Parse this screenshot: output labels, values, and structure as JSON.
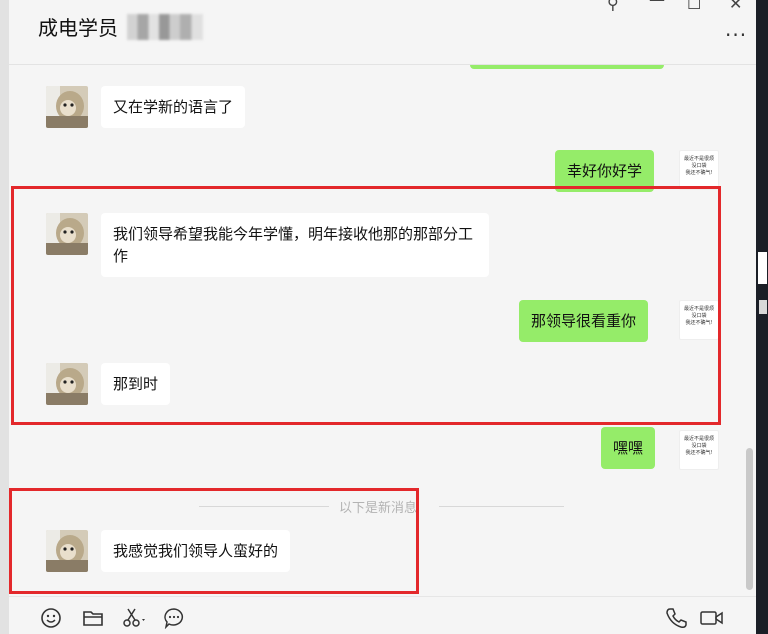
{
  "window": {
    "title": "成电学员",
    "more_label": "···",
    "controls": {
      "pin": "⚲",
      "minimize": "—",
      "maximize": "☐",
      "close": "✕"
    }
  },
  "messages": [
    {
      "sender": "other",
      "text": "又在学新的语言了"
    },
    {
      "sender": "me",
      "text": "幸好你好学"
    },
    {
      "sender": "other",
      "text": "我们领导希望我能今年学懂，明年接收他那的那部分工作"
    },
    {
      "sender": "me",
      "text": "那领导很看重你"
    },
    {
      "sender": "other",
      "text": "那到时"
    },
    {
      "sender": "me",
      "text": "嘿嘿"
    },
    {
      "sender": "other",
      "text": "我感觉我们领导人蛮好的"
    }
  ],
  "my_avatar_text": [
    "最近不是很烦",
    "没口袋",
    "我还不确气!"
  ],
  "separator": "以下是新消息",
  "toolbar": {
    "left_icons": [
      "emoji-icon",
      "folder-icon",
      "scissors-icon",
      "chat-bubble-icon"
    ],
    "right_icons": [
      "phone-icon",
      "video-icon"
    ]
  },
  "colors": {
    "my_bubble": "#95ec69",
    "their_bubble": "#ffffff",
    "annotation_box": "#e3282b"
  }
}
